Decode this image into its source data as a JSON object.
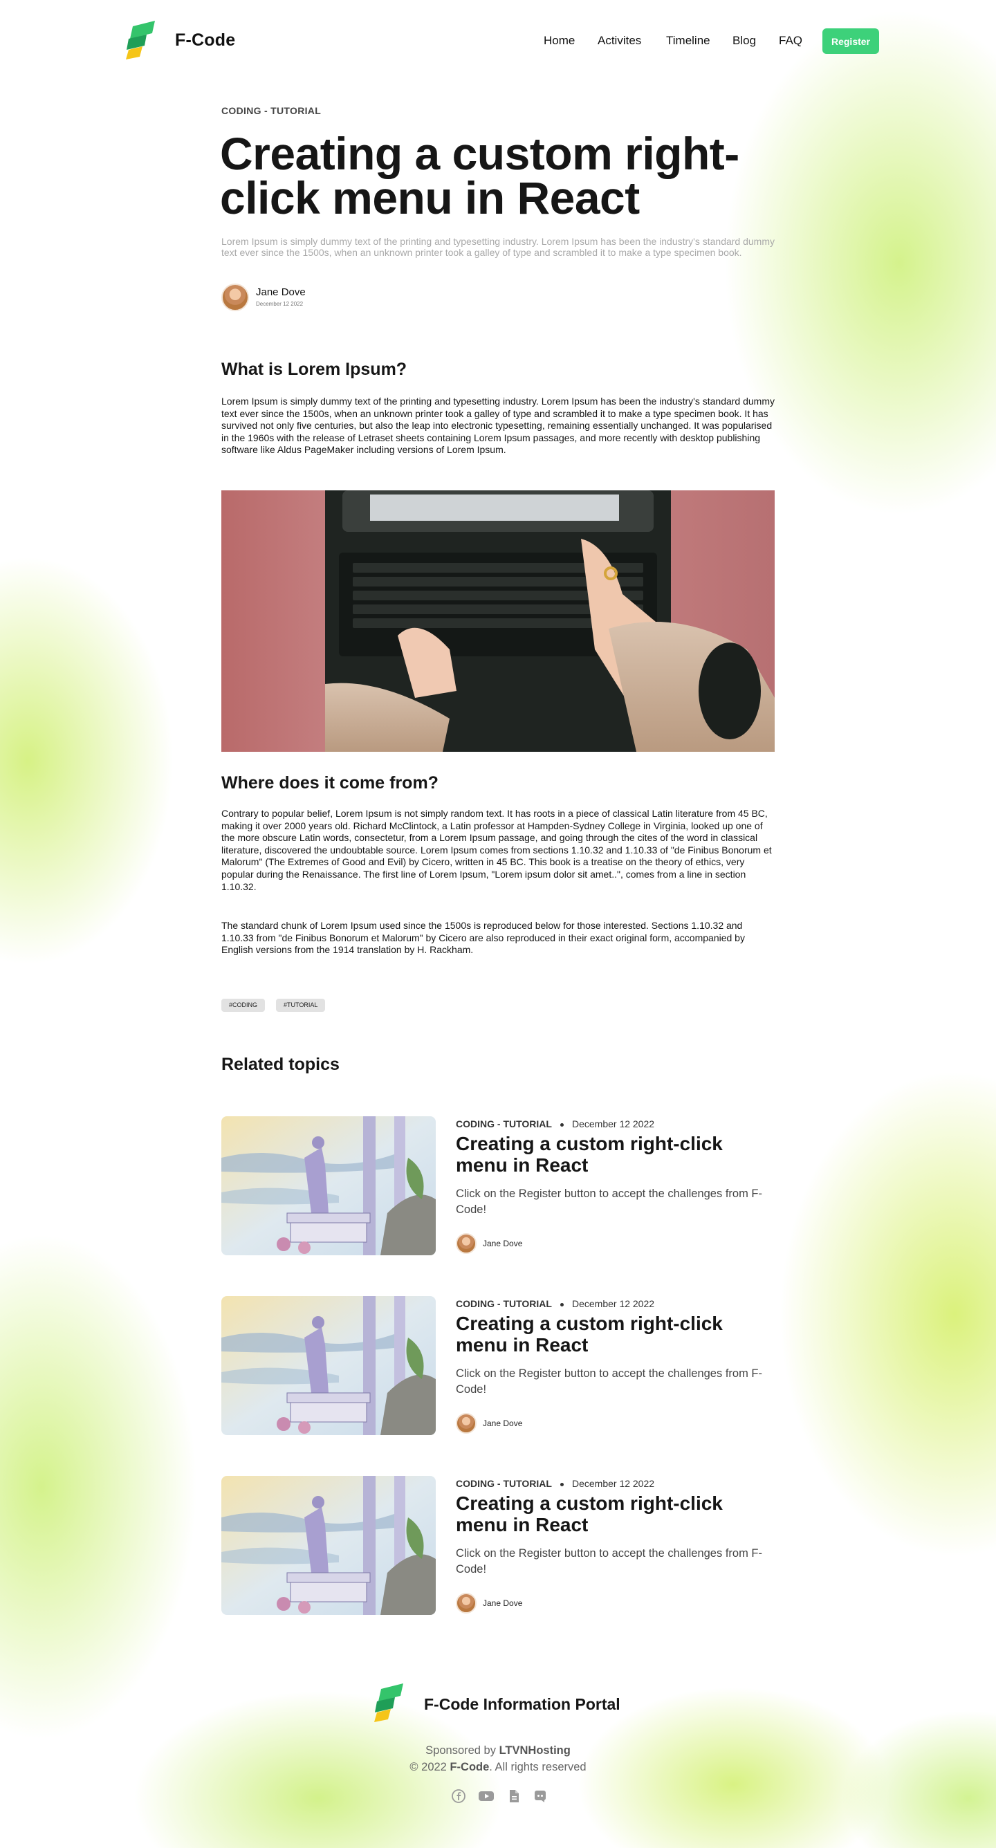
{
  "header": {
    "brand": "F-Code",
    "nav": [
      "Home",
      "Activites",
      "Timeline",
      "Blog",
      "FAQ"
    ],
    "register_label": "Register"
  },
  "article": {
    "category": "CODING - TUTORIAL",
    "title": "Creating a custom right-click menu in React",
    "lead": "Lorem Ipsum is simply dummy text of the printing and typesetting industry. Lorem Ipsum has been the industry's standard dummy text ever since the 1500s, when an unknown printer took a galley of type and scrambled it to make a type specimen book.",
    "author": {
      "name": "Jane Dove",
      "date": "December 12 2022"
    },
    "section1": {
      "heading": "What is Lorem Ipsum?",
      "body": "Lorem Ipsum is simply dummy text of the printing and typesetting industry. Lorem Ipsum has been the industry's standard dummy text ever since the 1500s, when an unknown printer took a galley of type and scrambled it to make a type specimen book. It has survived not only five centuries, but also the leap into electronic typesetting, remaining essentially unchanged. It was popularised in the 1960s with the release of Letraset sheets containing Lorem Ipsum passages, and more recently with desktop publishing software like Aldus PageMaker including versions of Lorem Ipsum."
    },
    "section2": {
      "heading": "Where does it come from?",
      "body1": "Contrary to popular belief, Lorem Ipsum is not simply random text. It has roots in a piece of classical Latin literature from 45 BC, making it over 2000 years old. Richard McClintock, a Latin professor at Hampden-Sydney College in Virginia, looked up one of the more obscure Latin words, consectetur, from a Lorem Ipsum passage, and going through the cites of the word in classical literature, discovered the undoubtable source. Lorem Ipsum comes from sections 1.10.32 and 1.10.33 of \"de Finibus Bonorum et Malorum\" (The Extremes of Good and Evil) by Cicero, written in 45 BC. This book is a treatise on the theory of ethics, very popular during the Renaissance. The first line of Lorem Ipsum, \"Lorem ipsum dolor sit amet..\", comes from a line in section 1.10.32.",
      "body2": "The standard chunk of Lorem Ipsum used since the 1500s is reproduced below for those interested. Sections 1.10.32 and 1.10.33 from \"de Finibus Bonorum et Malorum\" by Cicero are also reproduced in their exact original form, accompanied by English versions from the 1914 translation by H. Rackham."
    },
    "tags": [
      "#CODING",
      "#TUTORIAL"
    ]
  },
  "related": {
    "heading": "Related topics",
    "items": [
      {
        "category": "CODING - TUTORIAL",
        "date": "December 12 2022",
        "title": "Creating a custom right-click menu in React",
        "description": "Click on the Register button to accept the challenges from F-Code!",
        "author": "Jane Dove"
      },
      {
        "category": "CODING - TUTORIAL",
        "date": "December 12 2022",
        "title": "Creating a custom right-click menu in React",
        "description": "Click on the Register button to accept the challenges from F-Code!",
        "author": "Jane Dove"
      },
      {
        "category": "CODING - TUTORIAL",
        "date": "December 12 2022",
        "title": "Creating a custom right-click menu in React",
        "description": "Click on the Register button to accept the challenges from F-Code!",
        "author": "Jane Dove"
      }
    ]
  },
  "footer": {
    "brand": "F-Code Information Portal",
    "sponsored_prefix": "Sponsored by",
    "sponsor": "LTVNHosting",
    "copyright_prefix": "© 2022",
    "copyright_brand": "F-Code",
    "copyright_suffix": ". All rights reserved",
    "socials": [
      "facebook-icon",
      "youtube-icon",
      "document-icon",
      "discord-icon"
    ]
  },
  "colors": {
    "accent": "#3dd17a",
    "text": "#161616",
    "muted": "#a9a9a9"
  }
}
